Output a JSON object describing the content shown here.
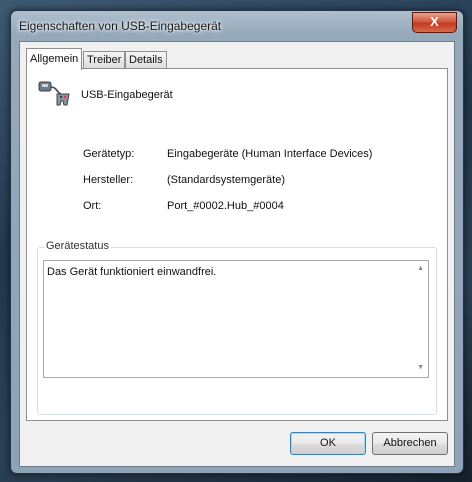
{
  "window": {
    "title": "Eigenschaften von USB-Eingabegerät",
    "close_label": "X"
  },
  "tabs": [
    {
      "label": "Allgemein",
      "active": true
    },
    {
      "label": "Treiber",
      "active": false
    },
    {
      "label": "Details",
      "active": false
    }
  ],
  "device": {
    "icon": "usb-device-icon",
    "name": "USB-Eingabegerät"
  },
  "properties": [
    {
      "label": "Gerätetyp:",
      "value": "Eingabegeräte (Human Interface Devices)"
    },
    {
      "label": "Hersteller:",
      "value": "(Standardsystemgeräte)"
    },
    {
      "label": "Ort:",
      "value": "Port_#0002.Hub_#0004"
    }
  ],
  "status": {
    "group_title": "Gerätestatus",
    "text": "Das Gerät funktioniert einwandfrei."
  },
  "buttons": {
    "ok": "OK",
    "cancel": "Abbrechen"
  }
}
